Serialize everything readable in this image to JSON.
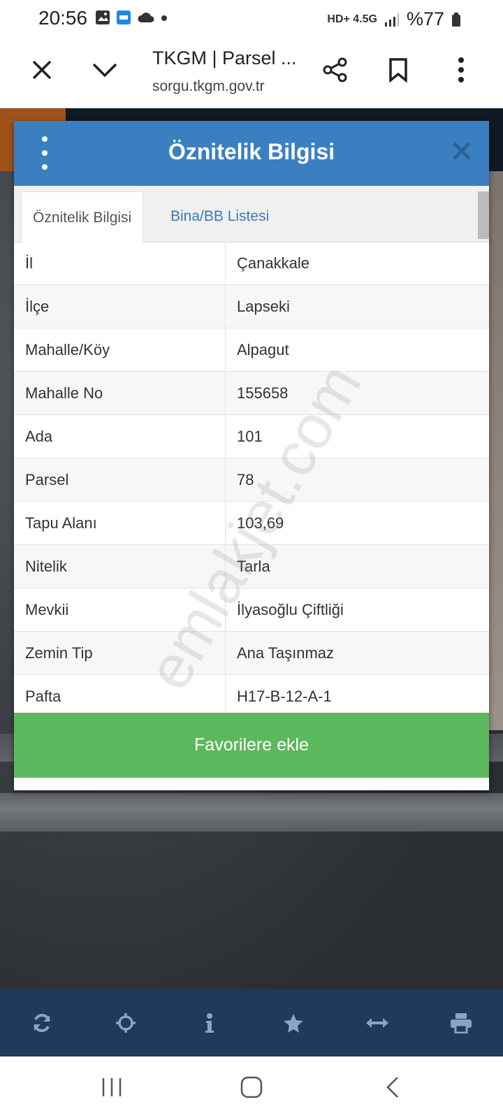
{
  "status_bar": {
    "time": "20:56",
    "network": "HD+ 4.5G",
    "battery": "%77"
  },
  "browser": {
    "title": "TKGM | Parsel ...",
    "url": "sorgu.tkgm.gov.tr"
  },
  "dialog": {
    "title": "Öznitelik Bilgisi",
    "tabs": [
      {
        "label": "Öznitelik Bilgisi",
        "active": true
      },
      {
        "label": "Bina/BB Listesi",
        "active": false
      }
    ],
    "rows": [
      {
        "key": "İl",
        "value": "Çanakkale"
      },
      {
        "key": "İlçe",
        "value": "Lapseki"
      },
      {
        "key": "Mahalle/Köy",
        "value": "Alpagut"
      },
      {
        "key": "Mahalle No",
        "value": "155658"
      },
      {
        "key": "Ada",
        "value": "101"
      },
      {
        "key": "Parsel",
        "value": "78"
      },
      {
        "key": "Tapu Alanı",
        "value": "103,69"
      },
      {
        "key": "Nitelik",
        "value": "Tarla"
      },
      {
        "key": "Mevkii",
        "value": "İlyasoğlu Çiftliği"
      },
      {
        "key": "Zemin Tip",
        "value": "Ana Taşınmaz"
      },
      {
        "key": "Pafta",
        "value": "H17-B-12-A-1"
      }
    ],
    "favorite_button": "Favorilere ekle"
  },
  "watermark": "emlakjet.com",
  "toolbar_icons": [
    "refresh-icon",
    "locate-icon",
    "info-icon",
    "star-icon",
    "measure-icon",
    "print-icon"
  ],
  "colors": {
    "header_blue": "#3a80c1",
    "fav_green": "#5cb85c",
    "toolbar_navy": "#1f3a5c"
  }
}
